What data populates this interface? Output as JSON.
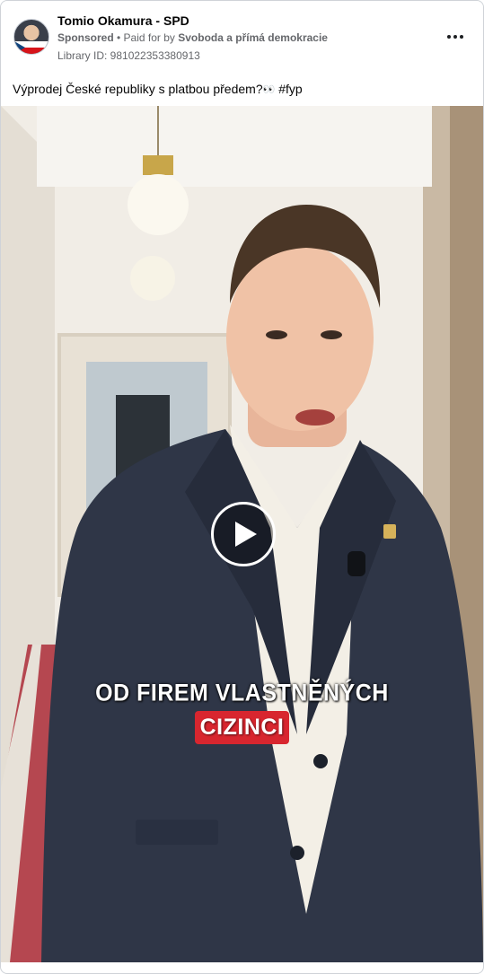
{
  "ad": {
    "page_name": "Tomio Okamura - SPD",
    "sponsored": "Sponsored",
    "bullet": " • ",
    "paid_for_by": "Paid for by ",
    "payer": "Svoboda a přímá demokracie",
    "library_id": "Library ID: 981022353380913",
    "caption": "Výprodej České republiky s platbou předem?",
    "caption_emoji": "👀",
    "caption_hashtag": " #fyp"
  },
  "video": {
    "subtitle_line1": "OD FIREM VLASTNĚNÝCH",
    "subtitle_line2": "CIZINCI",
    "play_icon": "play-icon",
    "more_icon": "more-options-icon"
  },
  "colors": {
    "subtitle_highlight": "#d8262f",
    "meta_text": "#65676b"
  }
}
